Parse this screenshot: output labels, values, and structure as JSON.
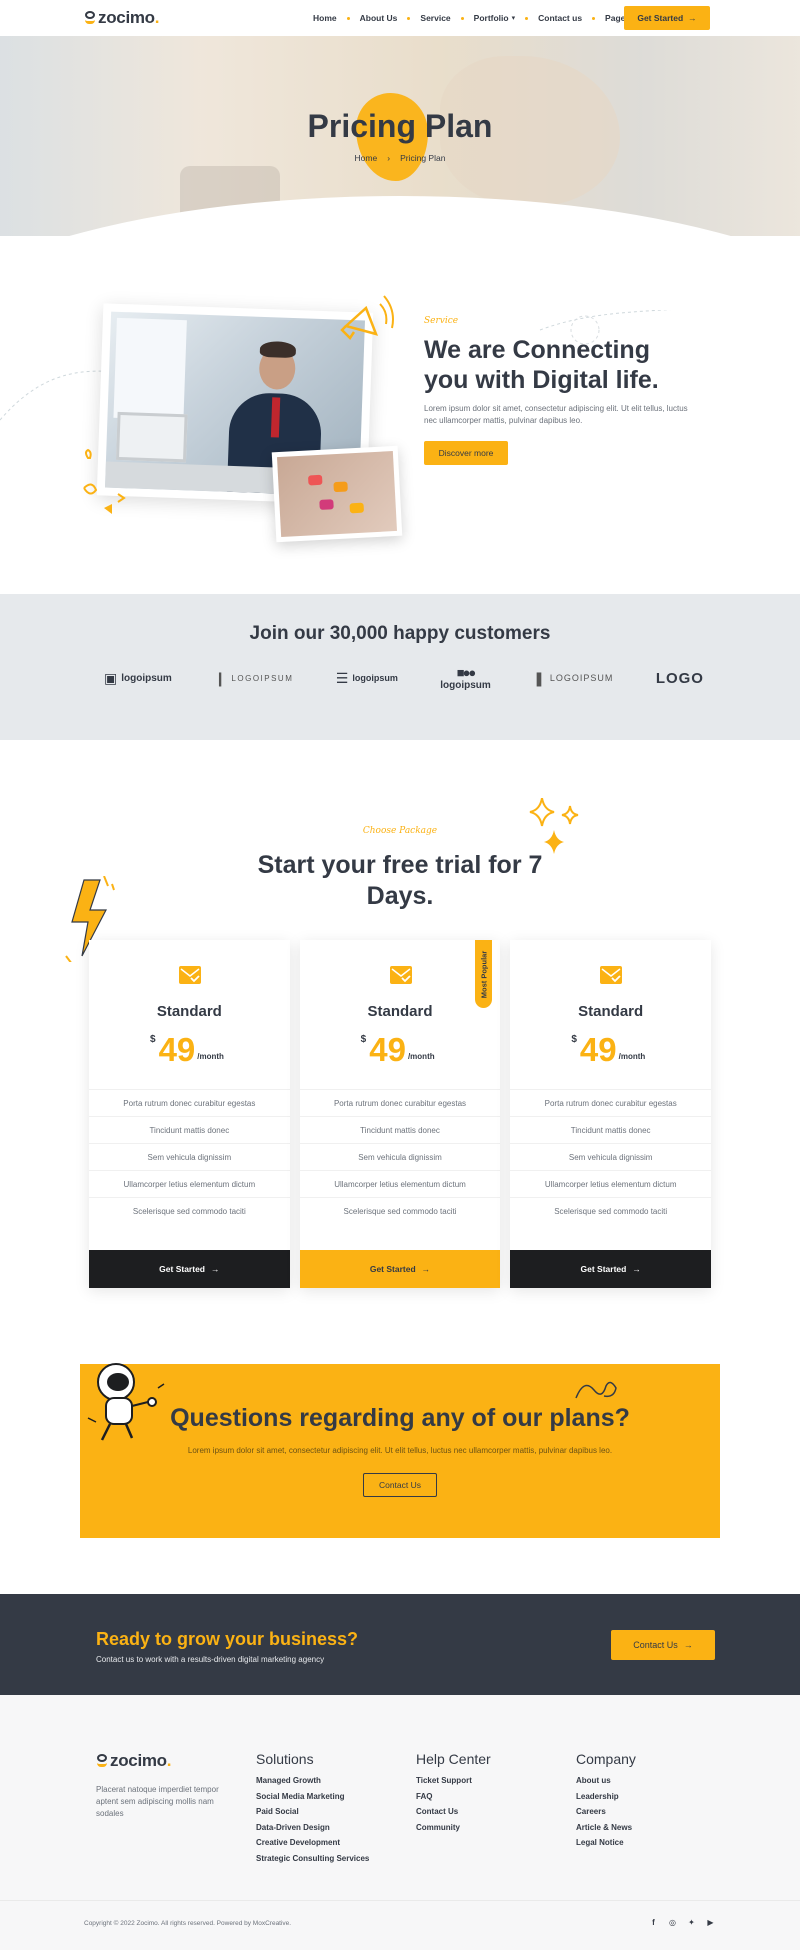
{
  "header": {
    "brand": "zocimo",
    "nav": [
      {
        "label": "Home"
      },
      {
        "label": "About Us"
      },
      {
        "label": "Service"
      },
      {
        "label": "Portfolio"
      },
      {
        "label": "Contact us"
      },
      {
        "label": "Page"
      }
    ],
    "cta_label": "Get Started"
  },
  "hero": {
    "title": "Pricing Plan",
    "breadcrumb": [
      "Home",
      "Pricing Plan"
    ]
  },
  "about": {
    "subtitle": "Service",
    "title": "We are Connecting you with Digital life.",
    "description": "Lorem ipsum dolor sit amet, consectetur adipiscing elit. Ut elit tellus, luctus nec ullamcorper mattis, pulvinar dapibus leo.",
    "button": "Discover more"
  },
  "customers": {
    "title": "Join our 30,000 happy customers",
    "logos": [
      "logoipsum",
      "LOGOIPSUM",
      "logoipsum",
      "logoipsum",
      "LOGOIPSUM",
      "LOGO"
    ]
  },
  "pricing": {
    "subtitle": "Choose Package",
    "title": "Start your free trial for 7 Days.",
    "badge": "Most Popular",
    "plans": [
      {
        "name": "Standard",
        "currency": "$",
        "price": "49",
        "period": "/month",
        "features": [
          "Porta rutrum donec curabitur egestas",
          "Tincidunt mattis donec",
          "Sem vehicula dignissim",
          "Ullamcorper letius elementum dictum",
          "Scelerisque sed commodo taciti"
        ],
        "button": "Get Started"
      },
      {
        "name": "Standard",
        "currency": "$",
        "price": "49",
        "period": "/month",
        "features": [
          "Porta rutrum donec curabitur egestas",
          "Tincidunt mattis donec",
          "Sem vehicula dignissim",
          "Ullamcorper letius elementum dictum",
          "Scelerisque sed commodo taciti"
        ],
        "button": "Get Started"
      },
      {
        "name": "Standard",
        "currency": "$",
        "price": "49",
        "period": "/month",
        "features": [
          "Porta rutrum donec curabitur egestas",
          "Tincidunt mattis donec",
          "Sem vehicula dignissim",
          "Ullamcorper letius elementum dictum",
          "Scelerisque sed commodo taciti"
        ],
        "button": "Get Started"
      }
    ]
  },
  "questions": {
    "title": "Questions regarding any of our plans?",
    "description": "Lorem ipsum dolor sit amet, consectetur adipiscing elit. Ut elit tellus, luctus nec ullamcorper mattis, pulvinar dapibus leo.",
    "button": "Contact Us"
  },
  "cta": {
    "title": "Ready to grow your business?",
    "description": "Contact us to work with a results-driven digital marketing agency",
    "button": "Contact Us"
  },
  "footer": {
    "brand": "zocimo",
    "about": "Placerat natoque imperdiet tempor aptent sem adipiscing mollis nam sodales",
    "columns": [
      {
        "title": "Solutions",
        "links": [
          "Managed Growth",
          "Social Media Marketing",
          "Paid Social",
          "Data-Driven Design",
          "Creative Development",
          "Strategic Consulting Services"
        ]
      },
      {
        "title": "Help Center",
        "links": [
          "Ticket Support",
          "FAQ",
          "Contact Us",
          "Community"
        ]
      },
      {
        "title": "Company",
        "links": [
          "About us",
          "Leadership",
          "Careers",
          "Article & News",
          "Legal Notice"
        ]
      }
    ],
    "copyright": "Copyright © 2022 Zocimo. All rights reserved. Powered by MoxCreative.",
    "socials": [
      "facebook-icon",
      "instagram-icon",
      "twitter-icon",
      "youtube-icon"
    ]
  },
  "colors": {
    "accent": "#fbb214",
    "dark": "#343a45",
    "black": "#1d1e20",
    "band": "#e6e9ec"
  }
}
